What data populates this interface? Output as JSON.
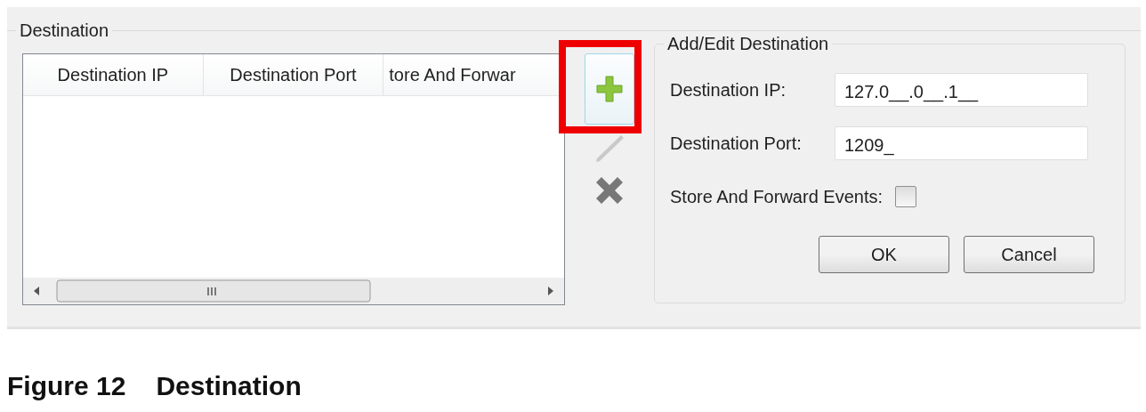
{
  "group": {
    "title": "Destination"
  },
  "table": {
    "columns": [
      "Destination IP",
      "Destination Port",
      "tore And Forwar"
    ]
  },
  "toolbar": {
    "buttons": [
      {
        "kind": "add",
        "disabled": false,
        "highlighted": true
      },
      {
        "kind": "edit",
        "disabled": true,
        "highlighted": false
      },
      {
        "kind": "delete",
        "disabled": false,
        "highlighted": false
      }
    ]
  },
  "form": {
    "title": "Add/Edit Destination",
    "fields": [
      {
        "kind": "text",
        "label": "Destination IP:",
        "value": "127.0__.0__.1__"
      },
      {
        "kind": "text",
        "label": "Destination Port:",
        "value": "1209_"
      },
      {
        "kind": "checkbox",
        "label": "Store And Forward Events:",
        "checked": false
      }
    ],
    "buttons": [
      "OK",
      "Cancel"
    ]
  },
  "caption": {
    "number": "Figure 12",
    "title": "Destination"
  }
}
